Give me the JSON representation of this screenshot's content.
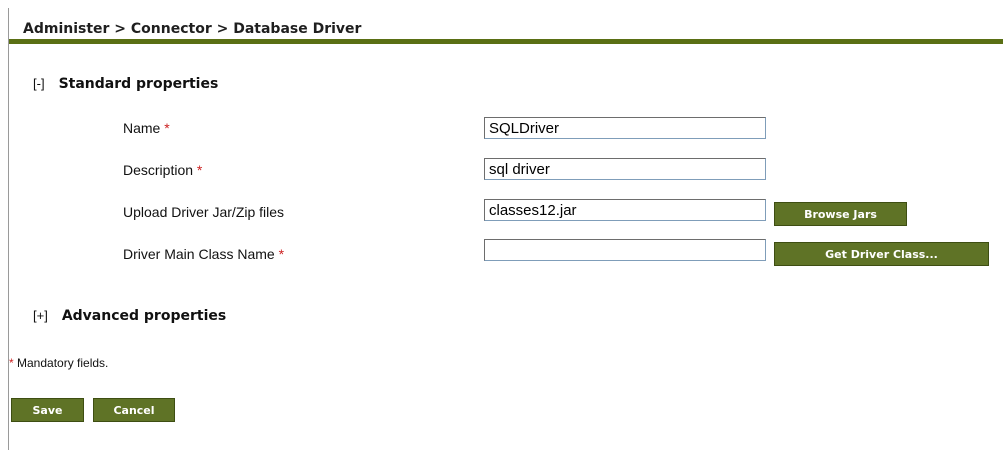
{
  "header": {
    "breadcrumb": "Administer > Connector > Database Driver"
  },
  "colors": {
    "accent": "#5f7326",
    "required": "#cc2222"
  },
  "standard_section": {
    "toggle": "[-]",
    "title": "Standard properties",
    "rows": [
      {
        "label": "Name",
        "required": "*",
        "value": "SQLDriver"
      },
      {
        "label": "Description",
        "required": "*",
        "value": "sql driver"
      },
      {
        "label": "Upload Driver Jar/Zip files",
        "required": "",
        "value": "classes12.jar",
        "button": "Browse Jars"
      },
      {
        "label": "Driver Main Class Name",
        "required": "*",
        "value": "",
        "button": "Get Driver Class..."
      }
    ]
  },
  "advanced_section": {
    "toggle": "[+]",
    "title": "Advanced properties"
  },
  "footer": {
    "mandatory_star": "*",
    "mandatory_note": "Mandatory fields.",
    "save_label": "Save",
    "cancel_label": "Cancel"
  }
}
